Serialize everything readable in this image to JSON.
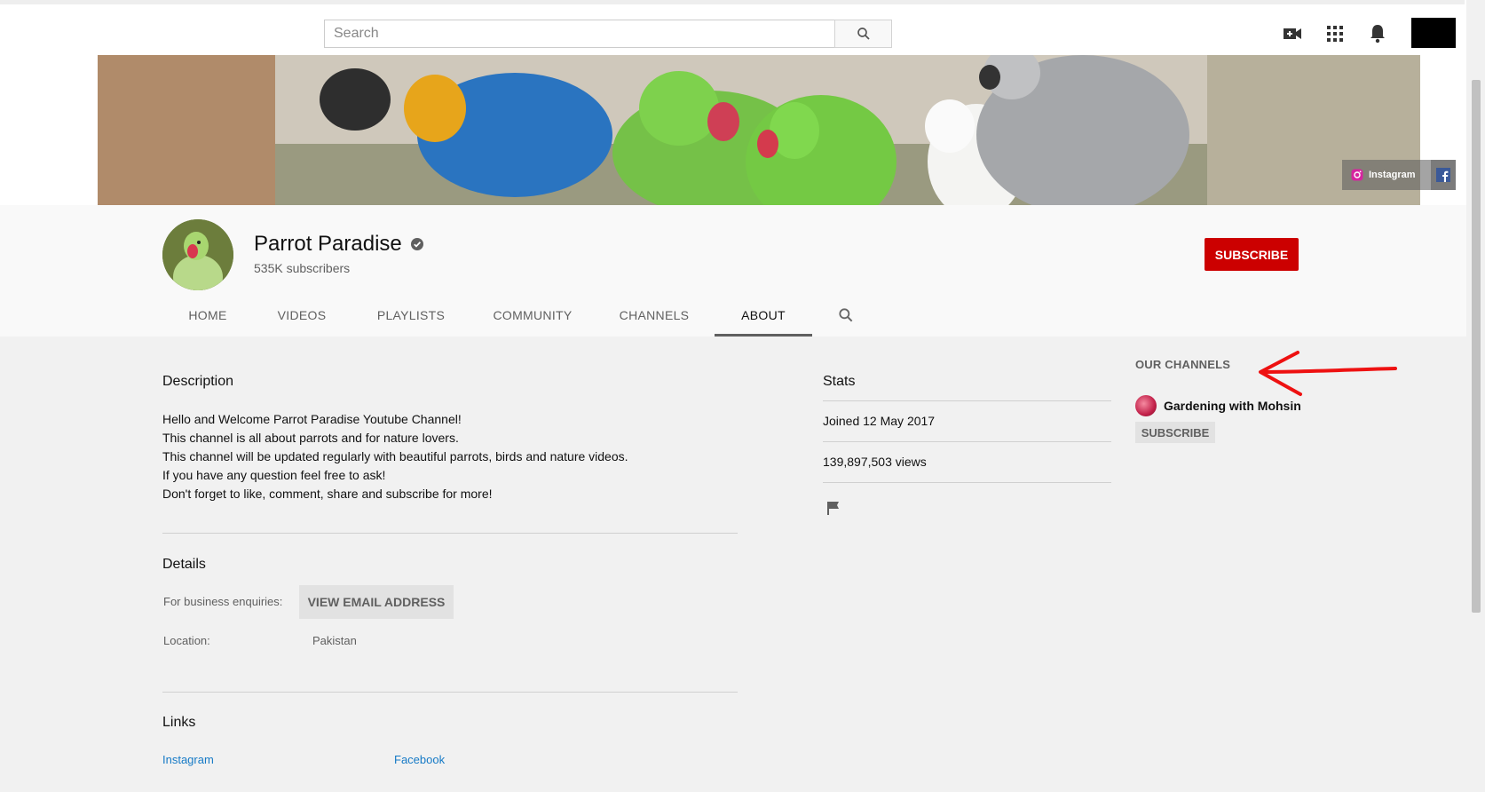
{
  "search": {
    "placeholder": "Search"
  },
  "topbar": {
    "icons": [
      "search-icon",
      "create-video-icon",
      "apps-grid-icon",
      "notifications-bell-icon"
    ]
  },
  "banner": {
    "links": [
      {
        "label": "Instagram",
        "icon": "instagram-icon"
      },
      {
        "label": "",
        "icon": "facebook-icon"
      }
    ]
  },
  "channel": {
    "name": "Parrot Paradise",
    "verified_icon": "verified-check-icon",
    "subscribers": "535K subscribers",
    "subscribe_label": "SUBSCRIBE"
  },
  "tabs": [
    {
      "label": "HOME"
    },
    {
      "label": "VIDEOS"
    },
    {
      "label": "PLAYLISTS"
    },
    {
      "label": "COMMUNITY"
    },
    {
      "label": "CHANNELS"
    },
    {
      "label": "ABOUT",
      "active": true
    }
  ],
  "about": {
    "description_title": "Description",
    "description_lines": [
      "Hello and Welcome Parrot Paradise Youtube Channel!",
      "This channel is all about parrots and for nature lovers.",
      "This channel will be updated regularly with beautiful parrots, birds and nature videos.",
      "If you have any question feel free to ask!",
      "Don't forget to like, comment, share and subscribe for more!"
    ],
    "details_title": "Details",
    "business_label": "For business enquiries:",
    "email_button": "VIEW EMAIL ADDRESS",
    "location_label": "Location:",
    "location_value": "Pakistan",
    "links_title": "Links",
    "links": [
      "Instagram",
      "Facebook"
    ]
  },
  "stats": {
    "title": "Stats",
    "joined": "Joined 12 May 2017",
    "views": "139,897,503 views",
    "flag_icon": "report-flag-icon"
  },
  "our_channels": {
    "title": "OUR CHANNELS",
    "items": [
      {
        "name": "Gardening with Mohsin",
        "subscribe_label": "SUBSCRIBE"
      }
    ]
  },
  "colors": {
    "subscribe_red": "#cc0000",
    "link_blue": "#167ac6",
    "annotation_red": "#ee1111"
  }
}
